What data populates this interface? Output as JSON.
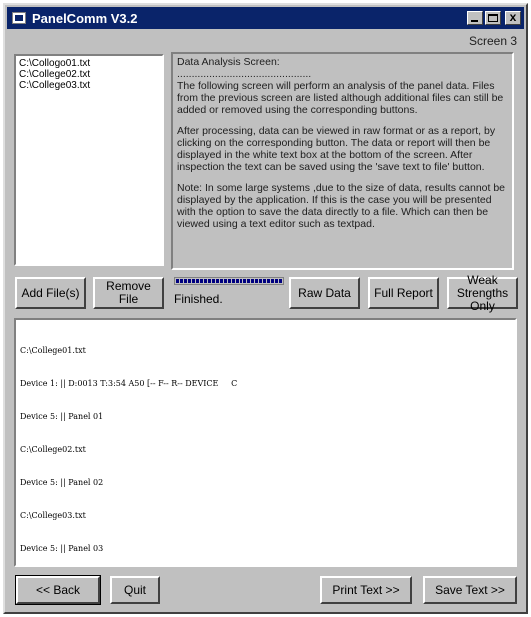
{
  "window": {
    "title": "PanelComm V3.2",
    "screen_label": "Screen 3",
    "close_glyph": "x"
  },
  "files": [
    "C:\\Collogo01.txt",
    "C:\\College02.txt",
    "C:\\College03.txt"
  ],
  "info": {
    "heading": "Data Analysis Screen:",
    "rule": "..............................................",
    "para1": "The following screen will perform an analysis of the panel data. Files from the previous screen are listed although additional files can still be added or removed using the corresponding buttons.",
    "para2": "After processing, data can be viewed in raw format or as a report, by clicking on the corresponding button. The data or report will then be displayed in the white text box at the bottom of the screen. After inspection the text can be saved using the 'save text to file' button.",
    "para3": "Note: In some large systems ,due to the size of data, results cannot be displayed by the application. If this is the case you will be presented with the option to save the data directly to a file. Which can then be viewed using a text editor such as textpad."
  },
  "buttons": {
    "add_files": "Add File(s)",
    "remove_file": "Remove File",
    "raw_data": "Raw Data",
    "full_report": "Full Report",
    "weak_strengths": "Weak\nStrengths Only",
    "back": "<< Back",
    "quit": "Quit",
    "print_text": "Print Text >>",
    "save_text": "Save Text >>"
  },
  "progress": {
    "status": "Finished.",
    "fraction": 1.0
  },
  "output_lines": [
    "C:\\College01.txt",
    "Device 1: || D:0013 T:3:54 A50 [-- F-- R-- DEVICE     C",
    "Device 5: || Panel 01",
    "C:\\College02.txt",
    "Device 5: || Panel 02",
    "C:\\College03.txt",
    "Device 5: || Panel 03"
  ],
  "colors": {
    "titlebar": "#0a246a",
    "face": "#c0c0c0",
    "progress": "#000080"
  }
}
